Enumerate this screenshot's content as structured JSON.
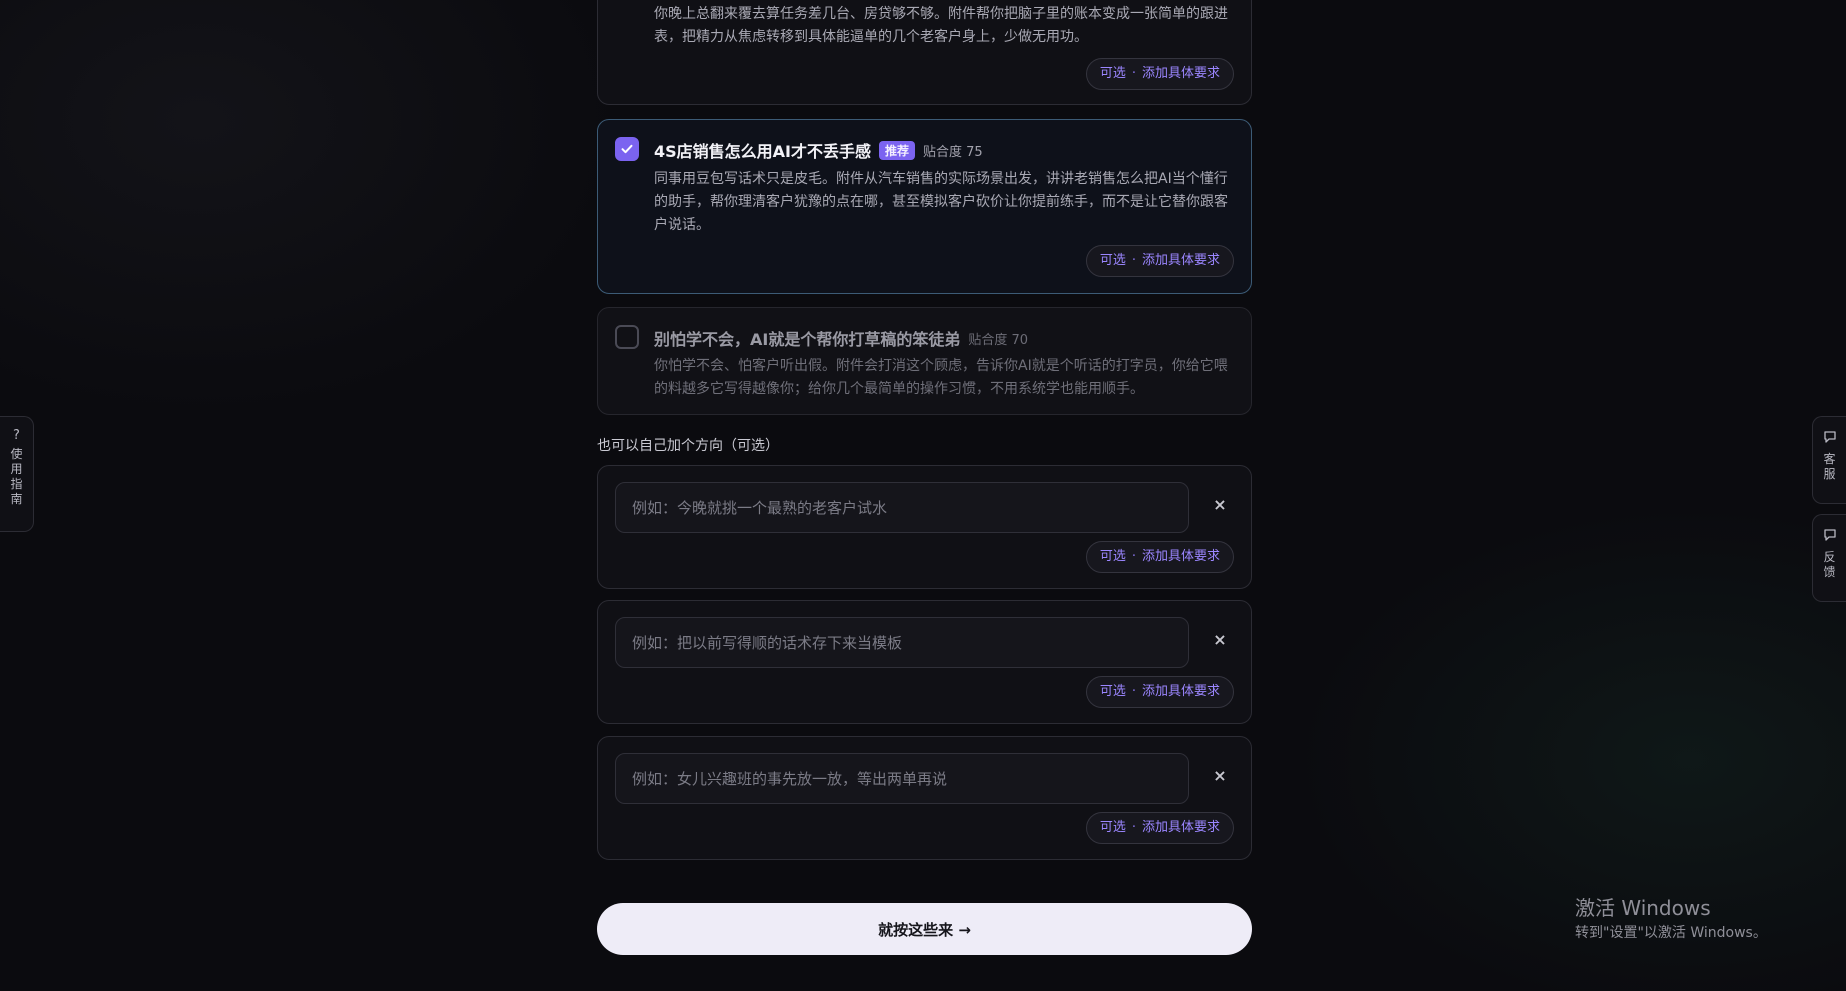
{
  "cards": [
    {
      "desc": "你晚上总翻来覆去算任务差几台、房贷够不够。附件帮你把脑子里的账本变成一张简单的跟进表，把精力从焦虑转移到具体能逼单的几个老客户身上，少做无用功。"
    },
    {
      "title": "4S店销售怎么用AI才不丢手感",
      "badge": "推荐",
      "fit": "贴合度 75",
      "desc": "同事用豆包写话术只是皮毛。附件从汽车销售的实际场景出发，讲讲老销售怎么把AI当个懂行的助手，帮你理清客户犹豫的点在哪，甚至模拟客户砍价让你提前练手，而不是让它替你跟客户说话。",
      "checked": true
    },
    {
      "title": "别怕学不会，AI就是个帮你打草稿的笨徒弟",
      "fit": "贴合度 70",
      "desc": "你怕学不会、怕客户听出假。附件会打消这个顾虑，告诉你AI就是个听话的打字员，你给它喂的料越多它写得越像你；给你几个最简单的操作习惯，不用系统学也能用顺手。",
      "checked": false
    }
  ],
  "pill": {
    "optional": "可选",
    "dot": "·",
    "action": "添加具体要求"
  },
  "custom_section_label": "也可以自己加个方向（可选）",
  "custom_inputs": [
    {
      "placeholder": "例如：今晚就挑一个最熟的老客户试水",
      "value": ""
    },
    {
      "placeholder": "例如：把以前写得顺的话术存下来当模板",
      "value": ""
    },
    {
      "placeholder": "例如：女儿兴趣班的事先放一放，等出两单再说",
      "value": ""
    }
  ],
  "remove_glyph": "×",
  "submit_label": "就按这些来 →",
  "side_tabs": {
    "guide": {
      "glyph": "?",
      "label": "使用指南"
    },
    "service": {
      "label": "客服"
    },
    "feedback": {
      "label": "反馈"
    }
  },
  "watermark": {
    "line1": "激活 Windows",
    "line2": "转到\"设置\"以激活 Windows。"
  }
}
